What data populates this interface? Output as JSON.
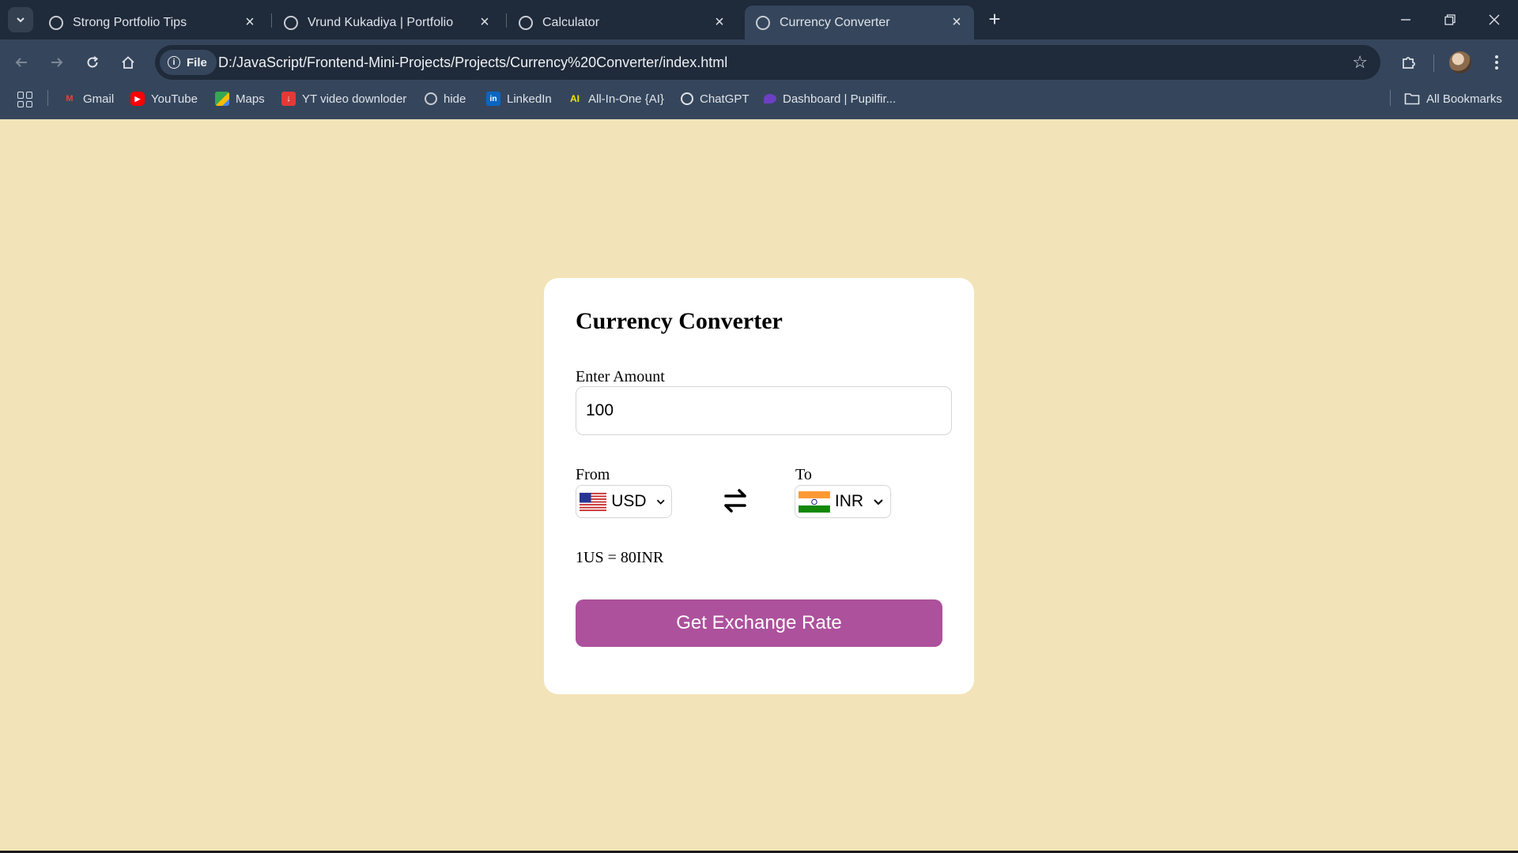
{
  "browser": {
    "tabs": [
      {
        "title": "Strong Portfolio Tips",
        "active": false
      },
      {
        "title": "Vrund Kukadiya | Portfolio",
        "active": false
      },
      {
        "title": "Calculator",
        "active": false
      },
      {
        "title": "Currency Converter",
        "active": true
      }
    ],
    "site_chip": "File",
    "url": "D:/JavaScript/Frontend-Mini-Projects/Projects/Currency%20Converter/index.html",
    "bookmarks": [
      {
        "label": "Gmail",
        "icon": "gmail-icon",
        "color": "#ea4335"
      },
      {
        "label": "YouTube",
        "icon": "youtube-icon",
        "color": "#ff0000"
      },
      {
        "label": "Maps",
        "icon": "maps-icon",
        "color": "#34a853"
      },
      {
        "label": "YT video downloder",
        "icon": "download-icon",
        "color": "#e53935"
      },
      {
        "label": "hide",
        "icon": "globe-icon",
        "color": "#c8ccd3"
      },
      {
        "label": "LinkedIn",
        "icon": "linkedin-icon",
        "color": "#0a66c2"
      },
      {
        "label": "All-In-One {AI}",
        "icon": "ai-icon",
        "color": "#f2e200"
      },
      {
        "label": "ChatGPT",
        "icon": "chatgpt-icon",
        "color": "#dfe3ea"
      },
      {
        "label": "Dashboard | Pupilfir...",
        "icon": "dashboard-icon",
        "color": "#6c3fc4"
      }
    ],
    "all_bookmarks": "All Bookmarks"
  },
  "converter": {
    "title": "Currency Converter",
    "amount_label": "Enter Amount",
    "amount_value": "100",
    "from_label": "From",
    "from_currency": "USD",
    "to_label": "To",
    "to_currency": "INR",
    "rate_text": "1US = 80INR",
    "button_label": "Get Exchange Rate"
  },
  "colors": {
    "page_background": "#f3e3b8",
    "button": "#ad519c",
    "chrome_dark": "#1f2a3a",
    "chrome_light": "#35465c"
  }
}
